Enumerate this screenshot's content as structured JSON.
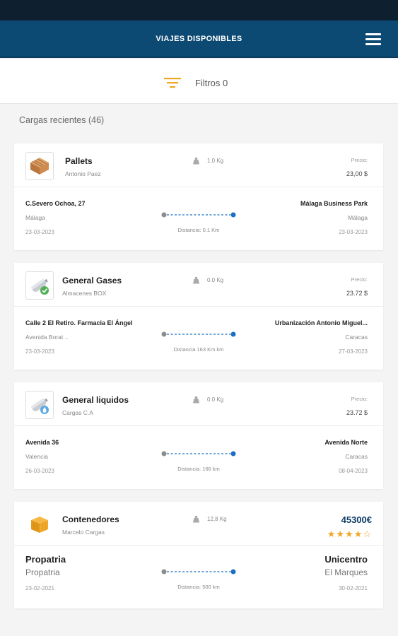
{
  "header": {
    "title": "VIAJES DISPONIBLES"
  },
  "filter": {
    "label": "Filtros 0"
  },
  "section_title": "Cargas recientes (46)",
  "cards": [
    {
      "name": "Pallets",
      "company": "Antonio Paez",
      "weight": "1.0 Kg",
      "price_label": "Precio:",
      "price": "23,00 $",
      "from": {
        "address": "C.Severo Ochoa, 27",
        "city": "Málaga",
        "date": "23-03-2023"
      },
      "to": {
        "address": "Málaga Business Park",
        "city": "Málaga",
        "date": "23-03-2023"
      },
      "distance": "Distancia: 0.1 Km"
    },
    {
      "name": "General Gases",
      "company": "Almacenes BOX",
      "weight": "0.0 Kg",
      "price_label": "Precio:",
      "price": "23.72 $",
      "from": {
        "address": "Calle 2 El Retiro. Farmacia El Ángel",
        "city": "Avenida Borat ..",
        "date": "23-03-2023"
      },
      "to": {
        "address": "Urbanización Antonio Miguel...",
        "city": "Caracas",
        "date": "27-03-2023"
      },
      "distance": "Distancia 163 Km km"
    },
    {
      "name": "General liquidos",
      "company": "Cargas C.A",
      "weight": "0.0 Kg",
      "price_label": "Precio:",
      "price": "23.72 $",
      "from": {
        "address": "Avenida 36",
        "city": "Valencia",
        "date": "26-03-2023"
      },
      "to": {
        "address": "Avenida Norte",
        "city": "Caracas",
        "date": "08-04-2023"
      },
      "distance": "Distancia: 166 km"
    },
    {
      "name": "Contenedores",
      "company": "Marcelo Cargas",
      "weight": "12,8 Kg",
      "price": "45300€",
      "rating": "4 of 5 stars",
      "from": {
        "address": "Propatria",
        "city": "Propatria",
        "date": "23-02-2021"
      },
      "to": {
        "address": "Unicentro",
        "city": "El Marques",
        "date": "30-02-2021"
      },
      "distance": "Distancia: 500 km"
    }
  ],
  "colors": {
    "appbar": "#0d4a73",
    "statusbar": "#0e1f2f",
    "accent": "#f0a623",
    "route": "#1a6fc4"
  },
  "icons": [
    "hamburger-menu-icon",
    "filter-icon",
    "weight-icon",
    "pallet-icon",
    "gas-cylinder-icon",
    "liquid-cylinder-icon",
    "container-box-icon",
    "star-icon"
  ]
}
